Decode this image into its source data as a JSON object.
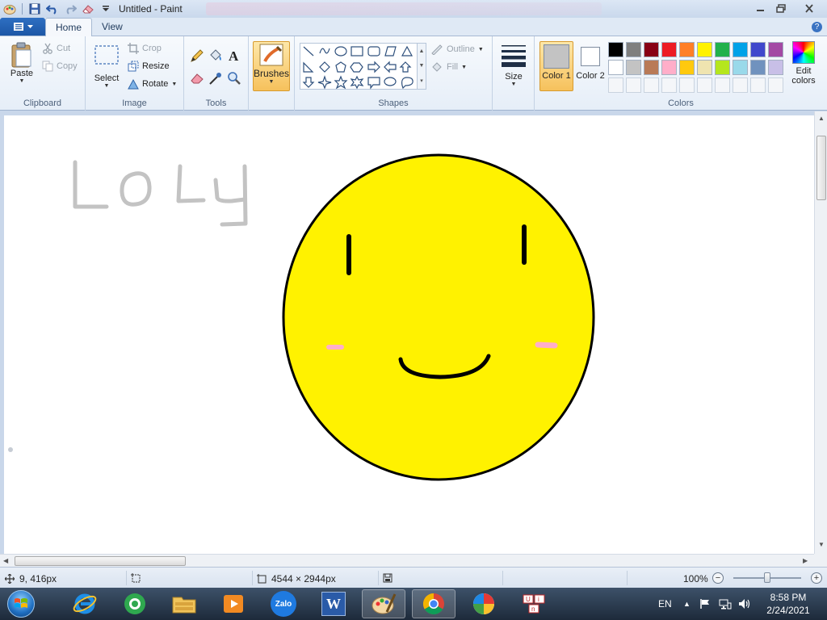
{
  "window": {
    "title": "Untitled - Paint",
    "controls": [
      "minimize",
      "restore",
      "close"
    ]
  },
  "quick_access": [
    "paint-app-icon",
    "save-icon",
    "undo-icon",
    "redo-icon",
    "eraser-icon",
    "customize-icon"
  ],
  "tabs": {
    "file_label": "",
    "home_label": "Home",
    "view_label": "View",
    "active": "Home"
  },
  "ribbon": {
    "clipboard": {
      "label": "Clipboard",
      "paste": "Paste",
      "cut": "Cut",
      "copy": "Copy"
    },
    "image": {
      "label": "Image",
      "select": "Select",
      "crop": "Crop",
      "resize": "Resize",
      "rotate": "Rotate"
    },
    "tools": {
      "label": "Tools",
      "items": [
        "pencil-icon",
        "fill-icon",
        "text-icon",
        "eraser-icon",
        "color-picker-icon",
        "magnifier-icon"
      ]
    },
    "brushes": {
      "label": "Brushes"
    },
    "shapes": {
      "label": "Shapes",
      "outline": "Outline",
      "fill": "Fill"
    },
    "size": {
      "label": "Size"
    },
    "colors": {
      "label": "Colors",
      "color1_label": "Color 1",
      "color2_label": "Color 2",
      "color1": "#c3c3c3",
      "color2": "#ffffff",
      "edit_colors": "Edit colors",
      "palette_row1": [
        "#000000",
        "#7f7f7f",
        "#880015",
        "#ed1c24",
        "#ff7f27",
        "#fff200",
        "#22b14c",
        "#00a2e8",
        "#3f48cc",
        "#a349a4"
      ],
      "palette_row2": [
        "#ffffff",
        "#c3c3c3",
        "#b97a57",
        "#ffaec9",
        "#ffc90e",
        "#efe4b0",
        "#b5e61d",
        "#99d9ea",
        "#7092be",
        "#c8bfe7"
      ],
      "palette_row3": [
        "#f4f6f9",
        "#f4f6f9",
        "#f4f6f9",
        "#f4f6f9",
        "#f4f6f9",
        "#f4f6f9",
        "#f4f6f9",
        "#f4f6f9",
        "#f4f6f9",
        "#f4f6f9"
      ]
    }
  },
  "canvas": {
    "text_drawing": "LOLY",
    "face_color": "#fff200",
    "cheek_color": "#ffaec9"
  },
  "statusbar": {
    "cursor_pos": "9, 416px",
    "image_size": "4544 × 2944px",
    "zoom": "100%",
    "zoom_level": 0.5
  },
  "taskbar": {
    "apps": [
      "internet-explorer-icon",
      "coccoc-browser-icon",
      "file-explorer-icon",
      "media-player-icon",
      "zalo-icon",
      "word-icon",
      "paint-icon",
      "chrome-icon",
      "color-app-icon",
      "unikey-icon"
    ],
    "zalo_label": "Zalo",
    "word_label": "W",
    "language": "EN",
    "time": "8:58 PM",
    "date": "2/24/2021"
  }
}
